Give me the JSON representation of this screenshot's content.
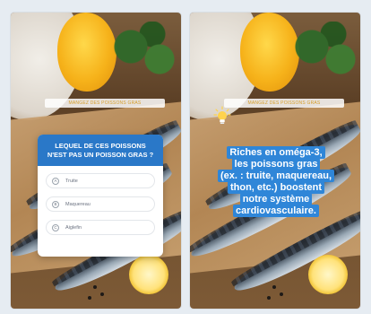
{
  "colors": {
    "accent_blue": "#2a78c8",
    "highlight_blue": "#2f86d8",
    "tag_text": "#d59d2a"
  },
  "left_story": {
    "tag_text": "Mangez Des Poissons Gras",
    "quiz": {
      "question": "Lequel de ces poissons n'est pas un poisson gras ?",
      "answers": [
        {
          "letter": "A",
          "text": "Truite"
        },
        {
          "letter": "B",
          "text": "Maquereau"
        },
        {
          "letter": "C",
          "text": "Aiglefin"
        }
      ]
    }
  },
  "right_story": {
    "tag_text": "Mangez Des Poissons Gras",
    "icon": "lightbulb-icon",
    "statement_lines": [
      "Riches en oméga-3,",
      "les poissons gras",
      "(ex. : truite, maquereau,",
      "thon, etc.) boostent",
      "notre système",
      "cardiovasculaire."
    ]
  }
}
